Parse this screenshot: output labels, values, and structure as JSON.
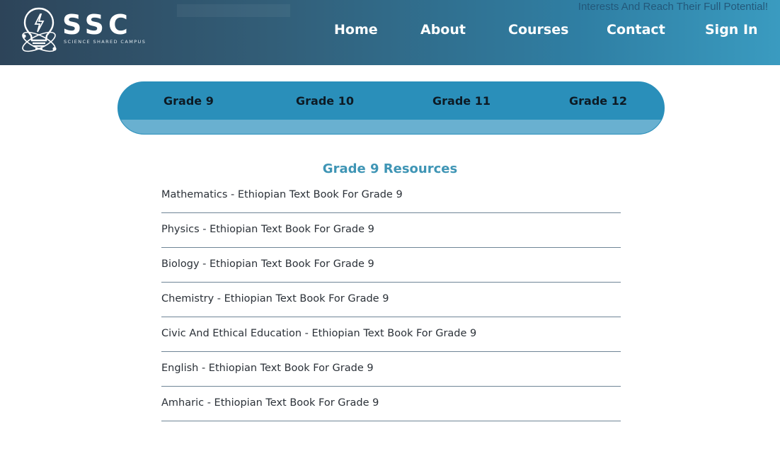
{
  "header": {
    "tagline": "Interests And Reach Their Full Potential!",
    "logo": {
      "text": "SSC",
      "subtitle": "SCIENCE SHARED CAMPUS",
      "icon": "lightbulb-atom-icon"
    },
    "nav": [
      {
        "label": "Home"
      },
      {
        "label": "About"
      },
      {
        "label": "Courses"
      },
      {
        "label": "Contact"
      },
      {
        "label": "Sign In"
      }
    ]
  },
  "grades": {
    "tabs": [
      {
        "label": "Grade 9"
      },
      {
        "label": "Grade 10"
      },
      {
        "label": "Grade 11"
      },
      {
        "label": "Grade 12"
      }
    ]
  },
  "resources": {
    "title": "Grade 9 Resources",
    "items": [
      {
        "label": "Mathematics - Ethiopian Text Book For Grade 9"
      },
      {
        "label": "Physics - Ethiopian Text Book For Grade 9"
      },
      {
        "label": "Biology - Ethiopian Text Book For Grade 9"
      },
      {
        "label": "Chemistry - Ethiopian Text Book For Grade 9"
      },
      {
        "label": "Civic And Ethical Education - Ethiopian Text Book For Grade 9"
      },
      {
        "label": "English - Ethiopian Text Book For Grade 9"
      },
      {
        "label": "Amharic - Ethiopian Text Book For Grade 9"
      }
    ]
  },
  "colors": {
    "header_start": "#2d4459",
    "header_end": "#3a9bc0",
    "grade_bar": "#2a8fba",
    "grade_bar_strip": "#69b0d0",
    "title_accent": "#3f95b5",
    "divider": "#6f8596"
  }
}
